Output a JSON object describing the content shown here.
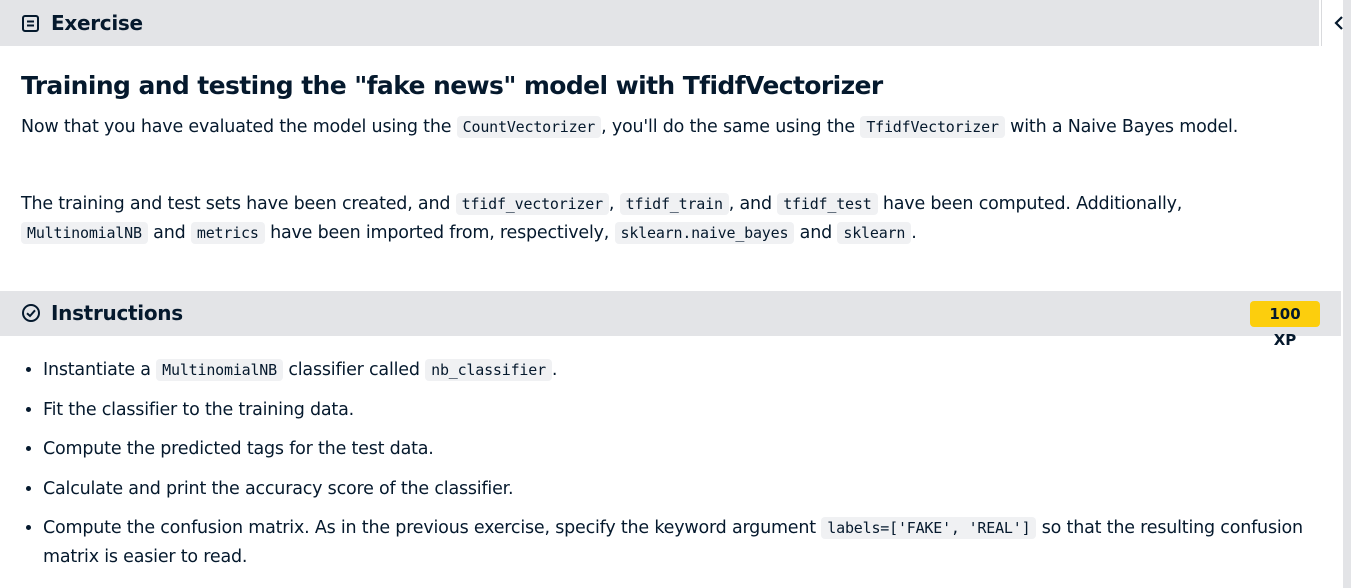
{
  "header": {
    "title": "Exercise",
    "icon": "document-icon"
  },
  "collapse": {
    "icon": "chevron-left-icon"
  },
  "exercise": {
    "title": "Training and testing the \"fake news\" model with TfidfVectorizer",
    "p1": {
      "t1": "Now that you have evaluated the model using the ",
      "c1": "CountVectorizer",
      "t2": ", you'll do the same using the ",
      "c2": "TfidfVectorizer",
      "t3": " with a Naive Bayes model."
    },
    "p2": {
      "t1": "The training and test sets have been created, and ",
      "c1": "tfidf_vectorizer",
      "t2": ", ",
      "c2": "tfidf_train",
      "t3": ", and ",
      "c3": "tfidf_test",
      "t4": " have been computed. Additionally, ",
      "c4": "MultinomialNB",
      "t5": " and ",
      "c5": "metrics",
      "t6": " have been imported from, respectively, ",
      "c6": "sklearn.naive_bayes",
      "t7": " and ",
      "c7": "sklearn",
      "t8": "."
    }
  },
  "instructions": {
    "title": "Instructions",
    "icon": "check-circle-icon",
    "xp": "100 XP",
    "xp_color": "#fcce0d",
    "steps": [
      {
        "t1": "Instantiate a ",
        "c1": "MultinomialNB",
        "t2": " classifier called ",
        "c2": "nb_classifier",
        "t3": "."
      },
      {
        "t1": "Fit the classifier to the training data."
      },
      {
        "t1": "Compute the predicted tags for the test data."
      },
      {
        "t1": "Calculate and print the accuracy score of the classifier."
      },
      {
        "t1": "Compute the confusion matrix. As in the previous exercise, specify the keyword argument ",
        "c1": "labels=['FAKE', 'REAL']",
        "t2": " so that the resulting confusion matrix is easier to read."
      }
    ]
  }
}
